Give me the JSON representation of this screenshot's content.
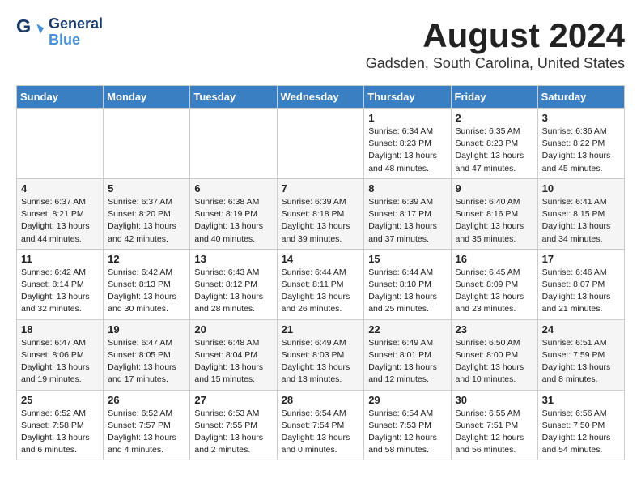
{
  "header": {
    "logo_line1": "General",
    "logo_line2": "Blue",
    "month": "August 2024",
    "location": "Gadsden, South Carolina, United States"
  },
  "weekdays": [
    "Sunday",
    "Monday",
    "Tuesday",
    "Wednesday",
    "Thursday",
    "Friday",
    "Saturday"
  ],
  "weeks": [
    [
      {
        "day": "",
        "info": ""
      },
      {
        "day": "",
        "info": ""
      },
      {
        "day": "",
        "info": ""
      },
      {
        "day": "",
        "info": ""
      },
      {
        "day": "1",
        "info": "Sunrise: 6:34 AM\nSunset: 8:23 PM\nDaylight: 13 hours\nand 48 minutes."
      },
      {
        "day": "2",
        "info": "Sunrise: 6:35 AM\nSunset: 8:23 PM\nDaylight: 13 hours\nand 47 minutes."
      },
      {
        "day": "3",
        "info": "Sunrise: 6:36 AM\nSunset: 8:22 PM\nDaylight: 13 hours\nand 45 minutes."
      }
    ],
    [
      {
        "day": "4",
        "info": "Sunrise: 6:37 AM\nSunset: 8:21 PM\nDaylight: 13 hours\nand 44 minutes."
      },
      {
        "day": "5",
        "info": "Sunrise: 6:37 AM\nSunset: 8:20 PM\nDaylight: 13 hours\nand 42 minutes."
      },
      {
        "day": "6",
        "info": "Sunrise: 6:38 AM\nSunset: 8:19 PM\nDaylight: 13 hours\nand 40 minutes."
      },
      {
        "day": "7",
        "info": "Sunrise: 6:39 AM\nSunset: 8:18 PM\nDaylight: 13 hours\nand 39 minutes."
      },
      {
        "day": "8",
        "info": "Sunrise: 6:39 AM\nSunset: 8:17 PM\nDaylight: 13 hours\nand 37 minutes."
      },
      {
        "day": "9",
        "info": "Sunrise: 6:40 AM\nSunset: 8:16 PM\nDaylight: 13 hours\nand 35 minutes."
      },
      {
        "day": "10",
        "info": "Sunrise: 6:41 AM\nSunset: 8:15 PM\nDaylight: 13 hours\nand 34 minutes."
      }
    ],
    [
      {
        "day": "11",
        "info": "Sunrise: 6:42 AM\nSunset: 8:14 PM\nDaylight: 13 hours\nand 32 minutes."
      },
      {
        "day": "12",
        "info": "Sunrise: 6:42 AM\nSunset: 8:13 PM\nDaylight: 13 hours\nand 30 minutes."
      },
      {
        "day": "13",
        "info": "Sunrise: 6:43 AM\nSunset: 8:12 PM\nDaylight: 13 hours\nand 28 minutes."
      },
      {
        "day": "14",
        "info": "Sunrise: 6:44 AM\nSunset: 8:11 PM\nDaylight: 13 hours\nand 26 minutes."
      },
      {
        "day": "15",
        "info": "Sunrise: 6:44 AM\nSunset: 8:10 PM\nDaylight: 13 hours\nand 25 minutes."
      },
      {
        "day": "16",
        "info": "Sunrise: 6:45 AM\nSunset: 8:09 PM\nDaylight: 13 hours\nand 23 minutes."
      },
      {
        "day": "17",
        "info": "Sunrise: 6:46 AM\nSunset: 8:07 PM\nDaylight: 13 hours\nand 21 minutes."
      }
    ],
    [
      {
        "day": "18",
        "info": "Sunrise: 6:47 AM\nSunset: 8:06 PM\nDaylight: 13 hours\nand 19 minutes."
      },
      {
        "day": "19",
        "info": "Sunrise: 6:47 AM\nSunset: 8:05 PM\nDaylight: 13 hours\nand 17 minutes."
      },
      {
        "day": "20",
        "info": "Sunrise: 6:48 AM\nSunset: 8:04 PM\nDaylight: 13 hours\nand 15 minutes."
      },
      {
        "day": "21",
        "info": "Sunrise: 6:49 AM\nSunset: 8:03 PM\nDaylight: 13 hours\nand 13 minutes."
      },
      {
        "day": "22",
        "info": "Sunrise: 6:49 AM\nSunset: 8:01 PM\nDaylight: 13 hours\nand 12 minutes."
      },
      {
        "day": "23",
        "info": "Sunrise: 6:50 AM\nSunset: 8:00 PM\nDaylight: 13 hours\nand 10 minutes."
      },
      {
        "day": "24",
        "info": "Sunrise: 6:51 AM\nSunset: 7:59 PM\nDaylight: 13 hours\nand 8 minutes."
      }
    ],
    [
      {
        "day": "25",
        "info": "Sunrise: 6:52 AM\nSunset: 7:58 PM\nDaylight: 13 hours\nand 6 minutes."
      },
      {
        "day": "26",
        "info": "Sunrise: 6:52 AM\nSunset: 7:57 PM\nDaylight: 13 hours\nand 4 minutes."
      },
      {
        "day": "27",
        "info": "Sunrise: 6:53 AM\nSunset: 7:55 PM\nDaylight: 13 hours\nand 2 minutes."
      },
      {
        "day": "28",
        "info": "Sunrise: 6:54 AM\nSunset: 7:54 PM\nDaylight: 13 hours\nand 0 minutes."
      },
      {
        "day": "29",
        "info": "Sunrise: 6:54 AM\nSunset: 7:53 PM\nDaylight: 12 hours\nand 58 minutes."
      },
      {
        "day": "30",
        "info": "Sunrise: 6:55 AM\nSunset: 7:51 PM\nDaylight: 12 hours\nand 56 minutes."
      },
      {
        "day": "31",
        "info": "Sunrise: 6:56 AM\nSunset: 7:50 PM\nDaylight: 12 hours\nand 54 minutes."
      }
    ]
  ]
}
